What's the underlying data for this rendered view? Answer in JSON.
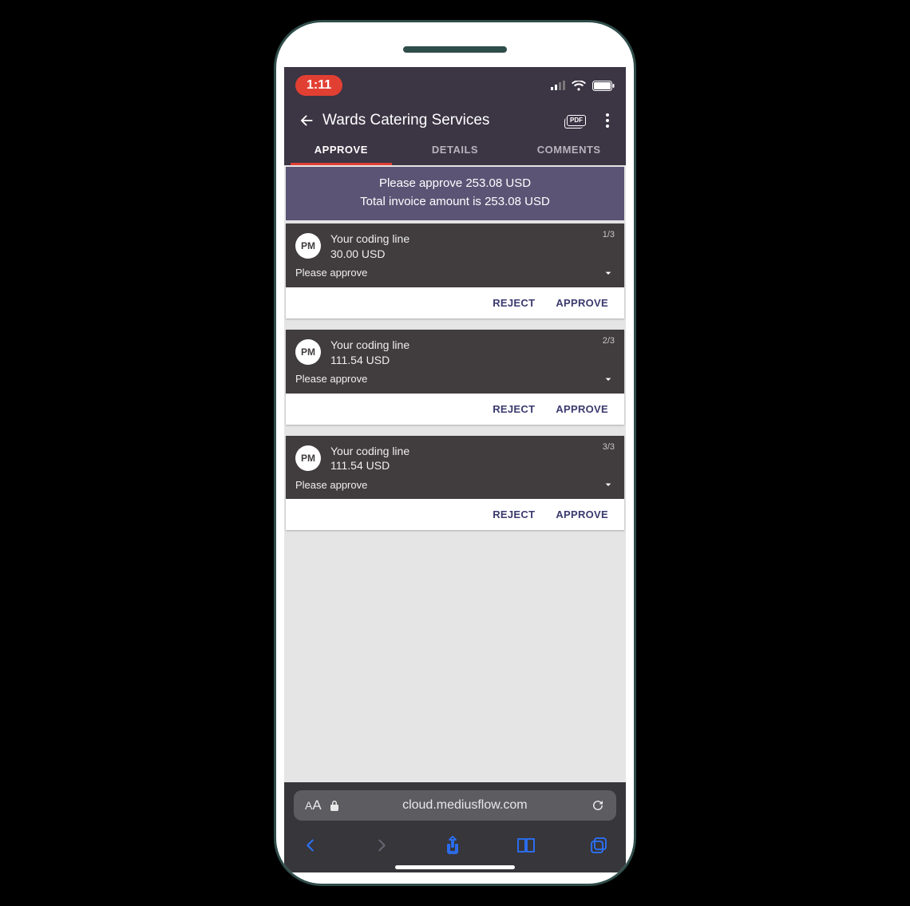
{
  "statusbar": {
    "time": "1:11"
  },
  "header": {
    "title": "Wards Catering Services",
    "pdf_label": "PDF"
  },
  "tabs": [
    {
      "label": "APPROVE",
      "active": true
    },
    {
      "label": "DETAILS",
      "active": false
    },
    {
      "label": "COMMENTS",
      "active": false
    }
  ],
  "banner": {
    "line1": "Please approve 253.08 USD",
    "line2": "Total invoice amount is 253.08 USD"
  },
  "avatar_initials": "PM",
  "items_title": "Your coding line",
  "items_prompt": "Please approve",
  "buttons": {
    "reject": "REJECT",
    "approve": "APPROVE"
  },
  "items": [
    {
      "amount": "30.00 USD",
      "counter": "1/3"
    },
    {
      "amount": "111.54 USD",
      "counter": "2/3"
    },
    {
      "amount": "111.54 USD",
      "counter": "3/3"
    }
  ],
  "browser": {
    "reader": "AA",
    "url": "cloud.mediusflow.com"
  },
  "colors": {
    "header_bg": "#3b3544",
    "banner_bg": "#5b5475",
    "card_head_bg": "#413c3e",
    "accent": "#e23f33",
    "action_text": "#3b3a6f",
    "safari_blue": "#2a73ff"
  }
}
